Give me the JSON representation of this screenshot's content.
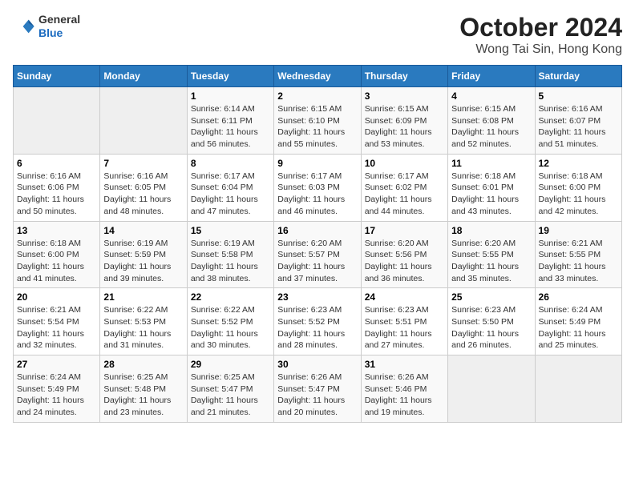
{
  "header": {
    "logo_line1": "General",
    "logo_line2": "Blue",
    "month": "October 2024",
    "location": "Wong Tai Sin, Hong Kong"
  },
  "days_of_week": [
    "Sunday",
    "Monday",
    "Tuesday",
    "Wednesday",
    "Thursday",
    "Friday",
    "Saturday"
  ],
  "weeks": [
    [
      {
        "day": "",
        "info": ""
      },
      {
        "day": "",
        "info": ""
      },
      {
        "day": "1",
        "info": "Sunrise: 6:14 AM\nSunset: 6:11 PM\nDaylight: 11 hours and 56 minutes."
      },
      {
        "day": "2",
        "info": "Sunrise: 6:15 AM\nSunset: 6:10 PM\nDaylight: 11 hours and 55 minutes."
      },
      {
        "day": "3",
        "info": "Sunrise: 6:15 AM\nSunset: 6:09 PM\nDaylight: 11 hours and 53 minutes."
      },
      {
        "day": "4",
        "info": "Sunrise: 6:15 AM\nSunset: 6:08 PM\nDaylight: 11 hours and 52 minutes."
      },
      {
        "day": "5",
        "info": "Sunrise: 6:16 AM\nSunset: 6:07 PM\nDaylight: 11 hours and 51 minutes."
      }
    ],
    [
      {
        "day": "6",
        "info": "Sunrise: 6:16 AM\nSunset: 6:06 PM\nDaylight: 11 hours and 50 minutes."
      },
      {
        "day": "7",
        "info": "Sunrise: 6:16 AM\nSunset: 6:05 PM\nDaylight: 11 hours and 48 minutes."
      },
      {
        "day": "8",
        "info": "Sunrise: 6:17 AM\nSunset: 6:04 PM\nDaylight: 11 hours and 47 minutes."
      },
      {
        "day": "9",
        "info": "Sunrise: 6:17 AM\nSunset: 6:03 PM\nDaylight: 11 hours and 46 minutes."
      },
      {
        "day": "10",
        "info": "Sunrise: 6:17 AM\nSunset: 6:02 PM\nDaylight: 11 hours and 44 minutes."
      },
      {
        "day": "11",
        "info": "Sunrise: 6:18 AM\nSunset: 6:01 PM\nDaylight: 11 hours and 43 minutes."
      },
      {
        "day": "12",
        "info": "Sunrise: 6:18 AM\nSunset: 6:00 PM\nDaylight: 11 hours and 42 minutes."
      }
    ],
    [
      {
        "day": "13",
        "info": "Sunrise: 6:18 AM\nSunset: 6:00 PM\nDaylight: 11 hours and 41 minutes."
      },
      {
        "day": "14",
        "info": "Sunrise: 6:19 AM\nSunset: 5:59 PM\nDaylight: 11 hours and 39 minutes."
      },
      {
        "day": "15",
        "info": "Sunrise: 6:19 AM\nSunset: 5:58 PM\nDaylight: 11 hours and 38 minutes."
      },
      {
        "day": "16",
        "info": "Sunrise: 6:20 AM\nSunset: 5:57 PM\nDaylight: 11 hours and 37 minutes."
      },
      {
        "day": "17",
        "info": "Sunrise: 6:20 AM\nSunset: 5:56 PM\nDaylight: 11 hours and 36 minutes."
      },
      {
        "day": "18",
        "info": "Sunrise: 6:20 AM\nSunset: 5:55 PM\nDaylight: 11 hours and 35 minutes."
      },
      {
        "day": "19",
        "info": "Sunrise: 6:21 AM\nSunset: 5:55 PM\nDaylight: 11 hours and 33 minutes."
      }
    ],
    [
      {
        "day": "20",
        "info": "Sunrise: 6:21 AM\nSunset: 5:54 PM\nDaylight: 11 hours and 32 minutes."
      },
      {
        "day": "21",
        "info": "Sunrise: 6:22 AM\nSunset: 5:53 PM\nDaylight: 11 hours and 31 minutes."
      },
      {
        "day": "22",
        "info": "Sunrise: 6:22 AM\nSunset: 5:52 PM\nDaylight: 11 hours and 30 minutes."
      },
      {
        "day": "23",
        "info": "Sunrise: 6:23 AM\nSunset: 5:52 PM\nDaylight: 11 hours and 28 minutes."
      },
      {
        "day": "24",
        "info": "Sunrise: 6:23 AM\nSunset: 5:51 PM\nDaylight: 11 hours and 27 minutes."
      },
      {
        "day": "25",
        "info": "Sunrise: 6:23 AM\nSunset: 5:50 PM\nDaylight: 11 hours and 26 minutes."
      },
      {
        "day": "26",
        "info": "Sunrise: 6:24 AM\nSunset: 5:49 PM\nDaylight: 11 hours and 25 minutes."
      }
    ],
    [
      {
        "day": "27",
        "info": "Sunrise: 6:24 AM\nSunset: 5:49 PM\nDaylight: 11 hours and 24 minutes."
      },
      {
        "day": "28",
        "info": "Sunrise: 6:25 AM\nSunset: 5:48 PM\nDaylight: 11 hours and 23 minutes."
      },
      {
        "day": "29",
        "info": "Sunrise: 6:25 AM\nSunset: 5:47 PM\nDaylight: 11 hours and 21 minutes."
      },
      {
        "day": "30",
        "info": "Sunrise: 6:26 AM\nSunset: 5:47 PM\nDaylight: 11 hours and 20 minutes."
      },
      {
        "day": "31",
        "info": "Sunrise: 6:26 AM\nSunset: 5:46 PM\nDaylight: 11 hours and 19 minutes."
      },
      {
        "day": "",
        "info": ""
      },
      {
        "day": "",
        "info": ""
      }
    ]
  ]
}
